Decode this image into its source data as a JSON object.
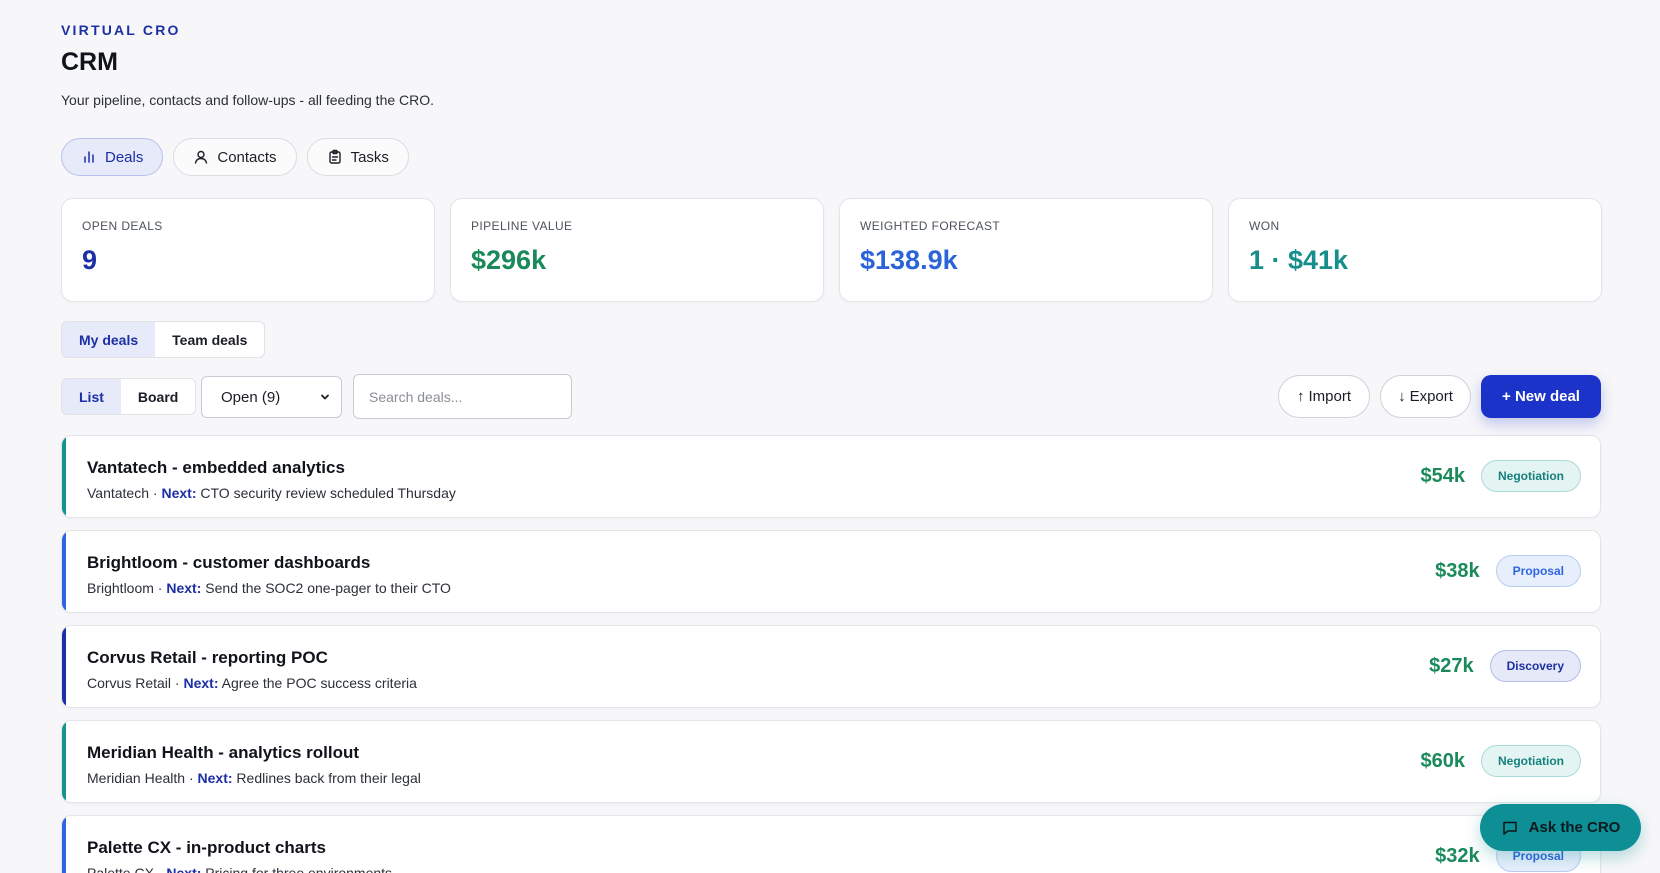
{
  "header": {
    "eyebrow": "VIRTUAL CRO",
    "title": "CRM",
    "subtitle": "Your pipeline, contacts and follow-ups - all feeding the CRO."
  },
  "nav_tabs": [
    {
      "label": "Deals",
      "icon": "bar-chart-icon",
      "active": true
    },
    {
      "label": "Contacts",
      "icon": "user-icon",
      "active": false
    },
    {
      "label": "Tasks",
      "icon": "clipboard-icon",
      "active": false
    }
  ],
  "stats": [
    {
      "label": "OPEN DEALS",
      "value": "9",
      "color": "#1c2fa5"
    },
    {
      "label": "PIPELINE VALUE",
      "value": "$296k",
      "color": "#1a8a5a"
    },
    {
      "label": "WEIGHTED FORECAST",
      "value": "$138.9k",
      "color": "#2b64d8"
    },
    {
      "label": "WON",
      "value": "1 · $41k",
      "color": "#168f8a"
    }
  ],
  "owner_filter": {
    "my": "My deals",
    "team": "Team deals",
    "active": "my"
  },
  "view_toggle": {
    "list": "List",
    "board": "Board",
    "active": "list"
  },
  "status_filter": {
    "selected": "Open (9)"
  },
  "search": {
    "placeholder": "Search deals..."
  },
  "actions": {
    "import": "Import",
    "export": "Export",
    "new_deal": "+ New deal"
  },
  "next_label": "Next:",
  "deals": [
    {
      "name": "Vantatech - embedded analytics",
      "company": "Vantatech",
      "next": "CTO security review scheduled Thursday",
      "value": "$54k",
      "stage": "Negotiation",
      "accent": "#14948e"
    },
    {
      "name": "Brightloom - customer dashboards",
      "company": "Brightloom",
      "next": "Send the SOC2 one-pager to their CTO",
      "value": "$38k",
      "stage": "Proposal",
      "accent": "#2f63e0"
    },
    {
      "name": "Corvus Retail - reporting POC",
      "company": "Corvus Retail",
      "next": "Agree the POC success criteria",
      "value": "$27k",
      "stage": "Discovery",
      "accent": "#1c2fa5"
    },
    {
      "name": "Meridian Health - analytics rollout",
      "company": "Meridian Health",
      "next": "Redlines back from their legal",
      "value": "$60k",
      "stage": "Negotiation",
      "accent": "#14948e"
    },
    {
      "name": "Palette CX - in-product charts",
      "company": "Palette CX",
      "next": "Pricing for three environments",
      "value": "$32k",
      "stage": "Proposal",
      "accent": "#2f63e0"
    }
  ],
  "stage_colors": {
    "Negotiation": {
      "bg": "#e4f4f3",
      "border": "#a9dcd8",
      "text": "#16817c"
    },
    "Proposal": {
      "bg": "#e8effc",
      "border": "#b9cdf3",
      "text": "#2f63e0"
    },
    "Discovery": {
      "bg": "#e6e9f8",
      "border": "#b5bde8",
      "text": "#1c2fa5"
    }
  },
  "assistant": {
    "label": "Ask the CRO"
  }
}
